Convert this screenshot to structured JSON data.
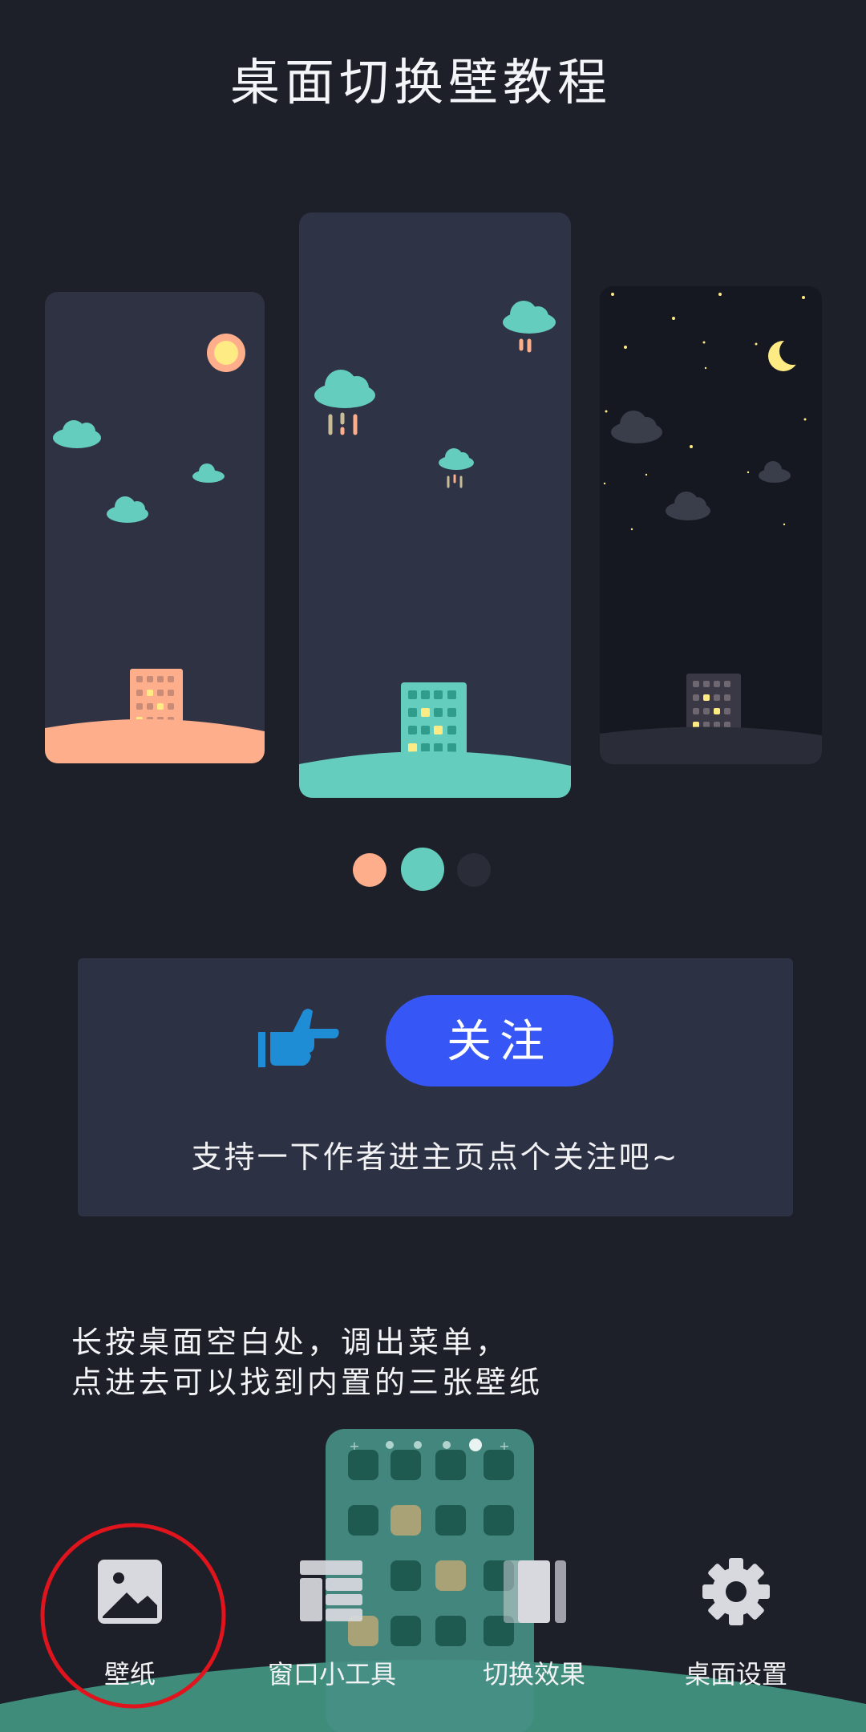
{
  "title": "桌面切换壁教程",
  "follow": {
    "button_label": "关注",
    "hint": "支持一下作者进主页点个关注吧~"
  },
  "instructions": {
    "line1": "长按桌面空白处，调出菜单，",
    "line2": "点进去可以找到内置的三张壁纸"
  },
  "carousel": {
    "current_index": 1,
    "count": 3,
    "dot_colors": [
      "#ffae8c",
      "#64cdbd",
      "#2a2d37"
    ]
  },
  "menu": {
    "items": [
      {
        "label": "壁纸",
        "icon": "image-icon"
      },
      {
        "label": "窗口小工具",
        "icon": "widgets-icon"
      },
      {
        "label": "切换效果",
        "icon": "transition-icon"
      },
      {
        "label": "桌面设置",
        "icon": "gear-icon"
      }
    ],
    "highlighted": "壁纸"
  },
  "colors": {
    "background": "#1d2029",
    "accent_blue": "#3656f5",
    "teal": "#64cdbd",
    "peach": "#ffae8c",
    "highlight_ring": "#e0141c"
  }
}
